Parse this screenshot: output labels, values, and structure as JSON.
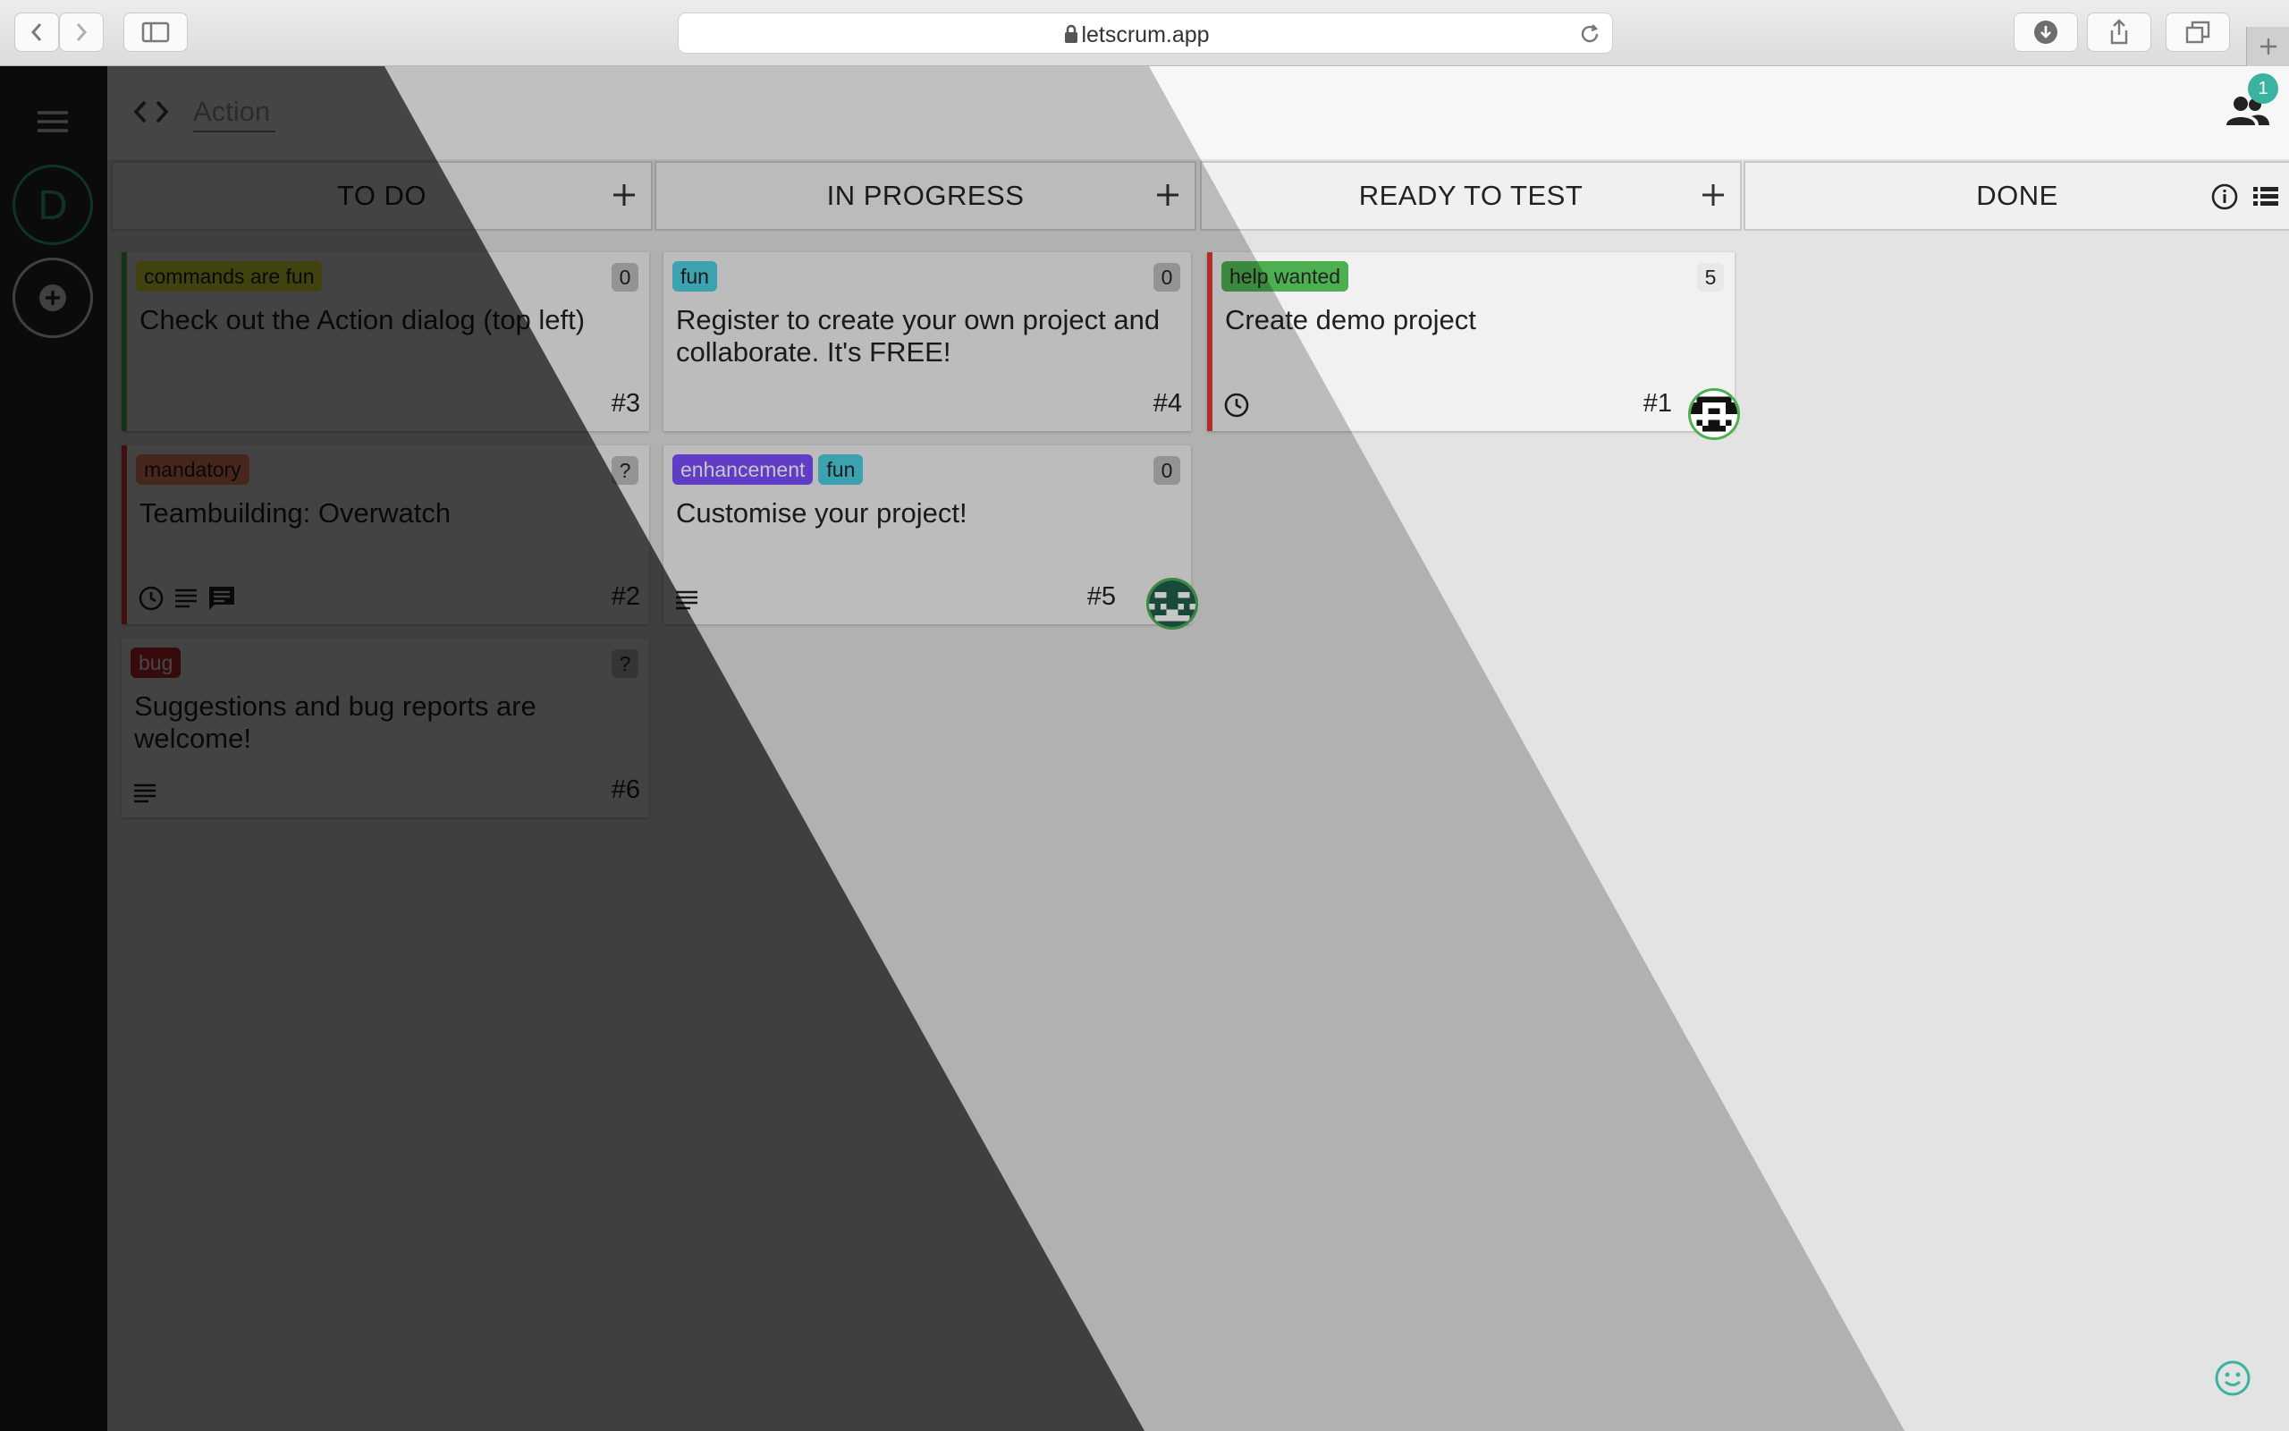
{
  "browser": {
    "url": "letscrum.app"
  },
  "topbar": {
    "action_placeholder": "Action",
    "online_count": "1"
  },
  "rail": {
    "project_initial": "D"
  },
  "columns": [
    {
      "title": "TO DO"
    },
    {
      "title": "IN PROGRESS"
    },
    {
      "title": "READY TO TEST"
    },
    {
      "title": "DONE"
    }
  ],
  "cards": {
    "todo": [
      {
        "label": "commands are fun",
        "count": "0",
        "title": "Check out the Action dialog (top left)",
        "number": "#3"
      },
      {
        "label": "mandatory",
        "count": "?",
        "title": "Teambuilding: Overwatch",
        "number": "#2"
      },
      {
        "label": "bug",
        "count": "?",
        "title": "Suggestions and bug reports are welcome!",
        "number": "#6"
      }
    ],
    "in_progress": [
      {
        "labels": [
          "fun"
        ],
        "count": "0",
        "title": "Register to create your own project and collaborate. It's FREE!",
        "number": "#4"
      },
      {
        "labels": [
          "enhancement",
          "fun"
        ],
        "count": "0",
        "title": "Customise your project!",
        "number": "#5"
      }
    ],
    "ready_to_test": [
      {
        "label": "help wanted",
        "count": "5",
        "title": "Create demo project",
        "number": "#1"
      }
    ]
  },
  "colors": {
    "accent": "#3bb3a2",
    "label_commands": "#e6f13a",
    "label_mandatory": "#ff8a65",
    "label_bug": "#c62828",
    "label_fun": "#4dd0e1",
    "label_enhancement": "#7c4dff",
    "label_help": "#4caf50"
  }
}
